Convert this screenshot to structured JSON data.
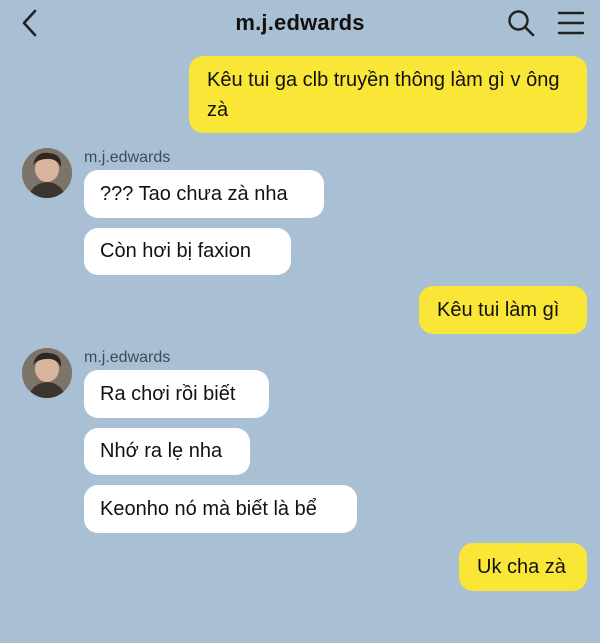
{
  "header": {
    "title": "m.j.edwards",
    "back_icon": "chevron-left-icon",
    "search_icon": "search-icon",
    "menu_icon": "hamburger-menu-icon"
  },
  "colors": {
    "background": "#a9bfd3",
    "sent_bubble": "#f9e636",
    "received_bubble": "#ffffff"
  },
  "messages": [
    {
      "direction": "sent",
      "text": "Kêu tui ga clb truyền thông làm gì v ông zà"
    },
    {
      "direction": "received",
      "sender": "m.j.edwards",
      "text": "??? Tao chưa zà nha"
    },
    {
      "direction": "received",
      "text": "Còn hơi bị faxion"
    },
    {
      "direction": "sent",
      "text": "Kêu tui làm gì"
    },
    {
      "direction": "received",
      "sender": "m.j.edwards",
      "text": "Ra chơi rồi biết"
    },
    {
      "direction": "received",
      "text": "Nhớ ra lẹ nha"
    },
    {
      "direction": "received",
      "text": "Keonho nó mà biết là bể"
    },
    {
      "direction": "sent",
      "text": "Uk cha zà"
    }
  ]
}
